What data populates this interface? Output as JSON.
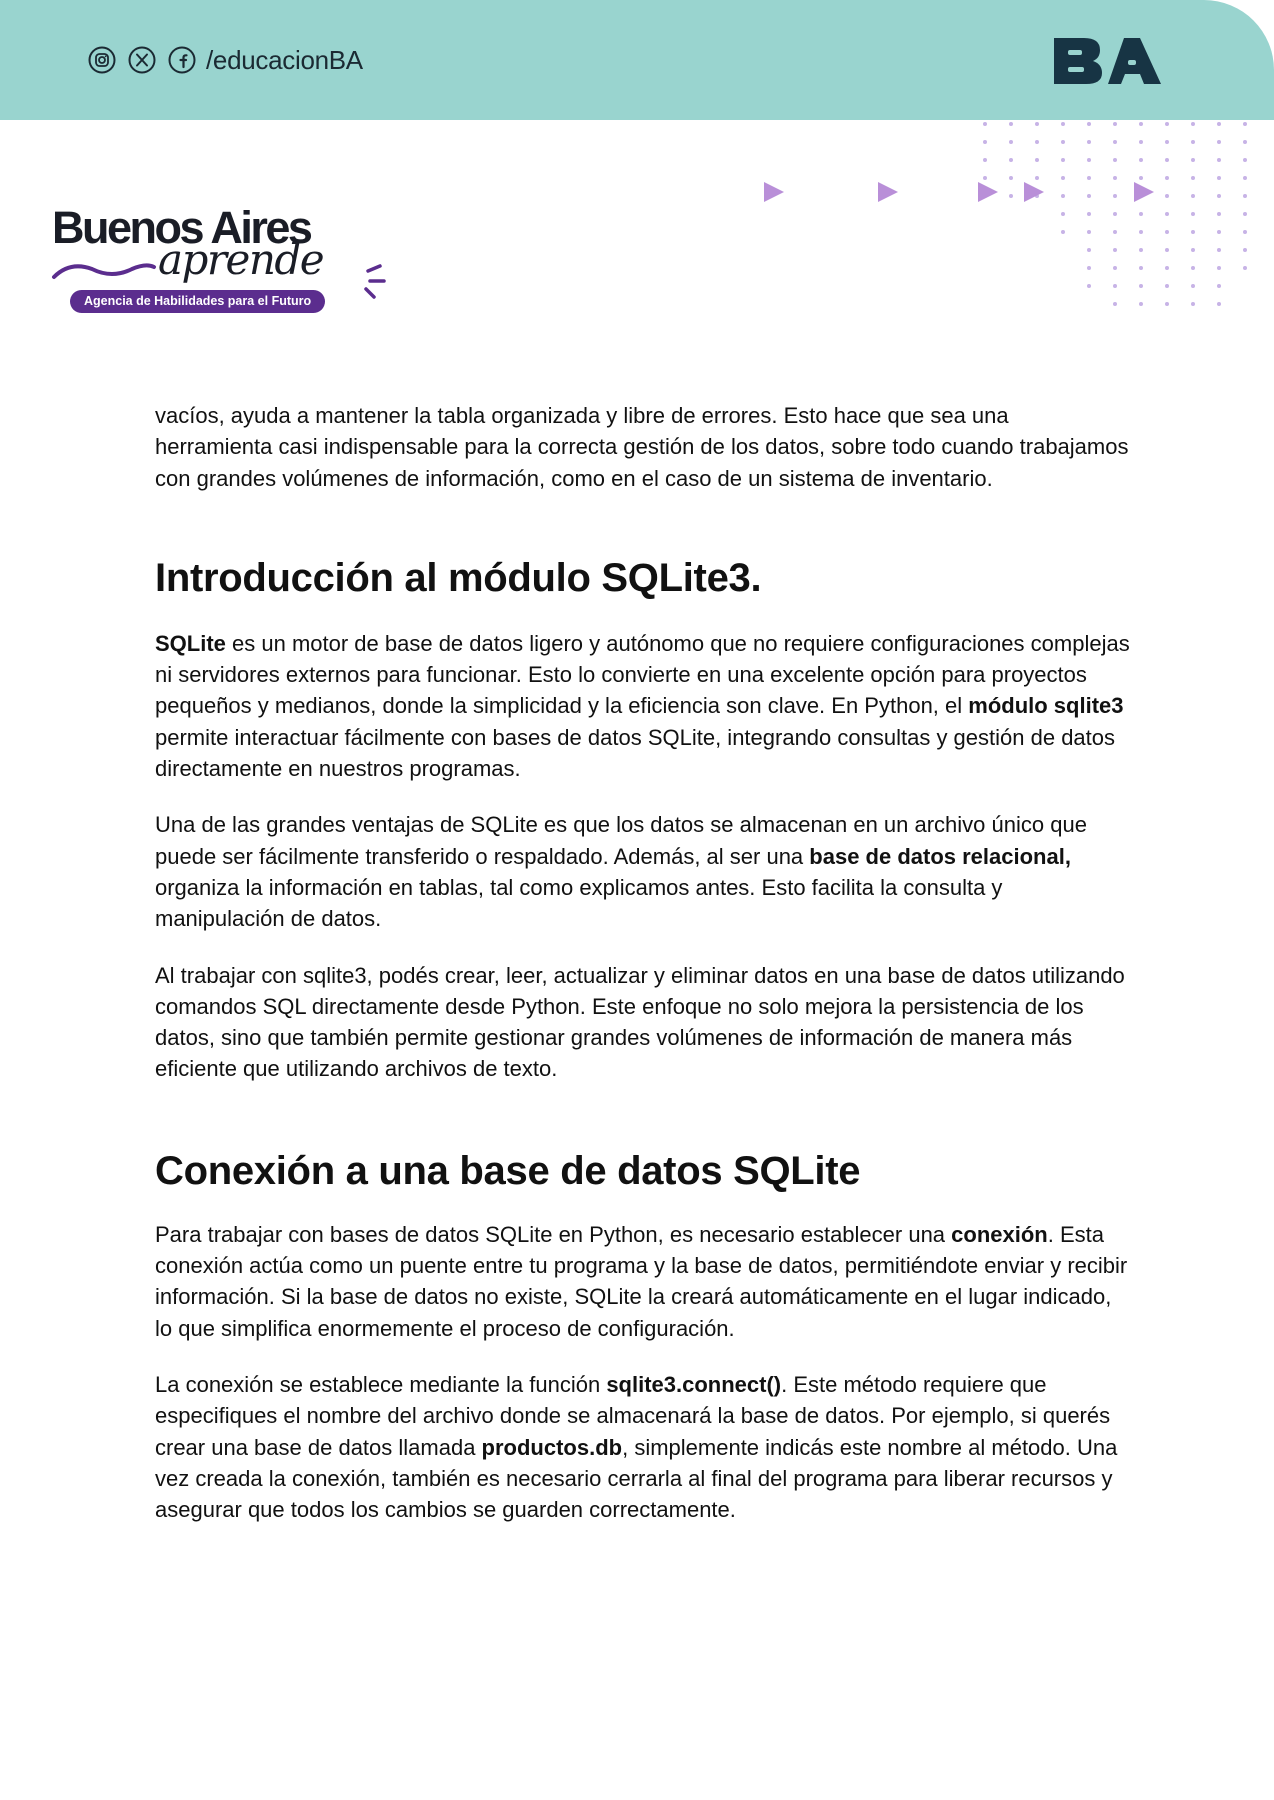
{
  "header": {
    "social_handle": "/educacionBA",
    "social_icons": [
      "instagram-icon",
      "x-icon",
      "facebook-icon"
    ],
    "ba_logo_text": "BA",
    "band_color": "#99d4cf"
  },
  "brand": {
    "line1": "Buenos Aires",
    "line2": "aprende",
    "tagline": "Agencia de Habilidades para el Futuro",
    "accent_color": "#5b2d8e"
  },
  "body": {
    "intro_paragraph": "vacíos, ayuda a mantener la tabla organizada y libre de errores. Esto hace que sea una herramienta casi indispensable para la correcta gestión de los datos, sobre todo cuando trabajamos con grandes volúmenes de información, como en el caso de un sistema de inventario.",
    "section1": {
      "heading": "Introducción al módulo SQLite3.",
      "p1": {
        "b1": "SQLite",
        "t1": " es un motor de base de datos ligero y autónomo que no requiere configuraciones complejas ni servidores externos para funcionar. Esto lo convierte en una excelente opción para proyectos pequeños y medianos, donde la simplicidad y la eficiencia son clave. En Python, el ",
        "b2": "módulo sqlite3",
        "t2": " permite interactuar fácilmente con bases de datos SQLite, integrando consultas y gestión de datos directamente en nuestros programas."
      },
      "p2": {
        "t1": "Una de las grandes ventajas de SQLite es que los datos se almacenan en un archivo único que puede ser fácilmente transferido o respaldado. Además, al ser una ",
        "b1": "base de datos relacional,",
        "t2": " organiza la información en tablas, tal como explicamos antes. Esto facilita la consulta y manipulación de datos."
      },
      "p3": "Al trabajar con sqlite3, podés crear, leer, actualizar y eliminar datos en una base de datos utilizando comandos SQL directamente desde Python. Este enfoque no solo mejora la persistencia de los datos, sino que también permite gestionar grandes volúmenes de información de manera más eficiente que utilizando archivos de texto."
    },
    "section2": {
      "heading": "Conexión a una base de datos SQLite",
      "p1": {
        "t1": "Para trabajar con bases de datos SQLite en Python, es necesario establecer una ",
        "b1": "conexión",
        "t2": ". Esta conexión actúa como un puente entre tu programa y la base de datos, permitiéndote enviar y recibir información. Si la base de datos no existe, SQLite la creará automáticamente en el lugar indicado, lo que simplifica enormemente el proceso de configuración."
      },
      "p2": {
        "t1": "La conexión se establece mediante la función ",
        "b1": "sqlite3.connect()",
        "t2": ". Este método requiere que especifiques el nombre del archivo donde se almacenará la base de datos. Por ejemplo, si querés crear una base de datos llamada ",
        "b2": "productos.db",
        "t3": ", simplemente indicás este nombre al método. Una vez creada la conexión, también es necesario cerrarla al final del programa para liberar recursos y asegurar que todos los cambios se guarden correctamente."
      }
    }
  }
}
